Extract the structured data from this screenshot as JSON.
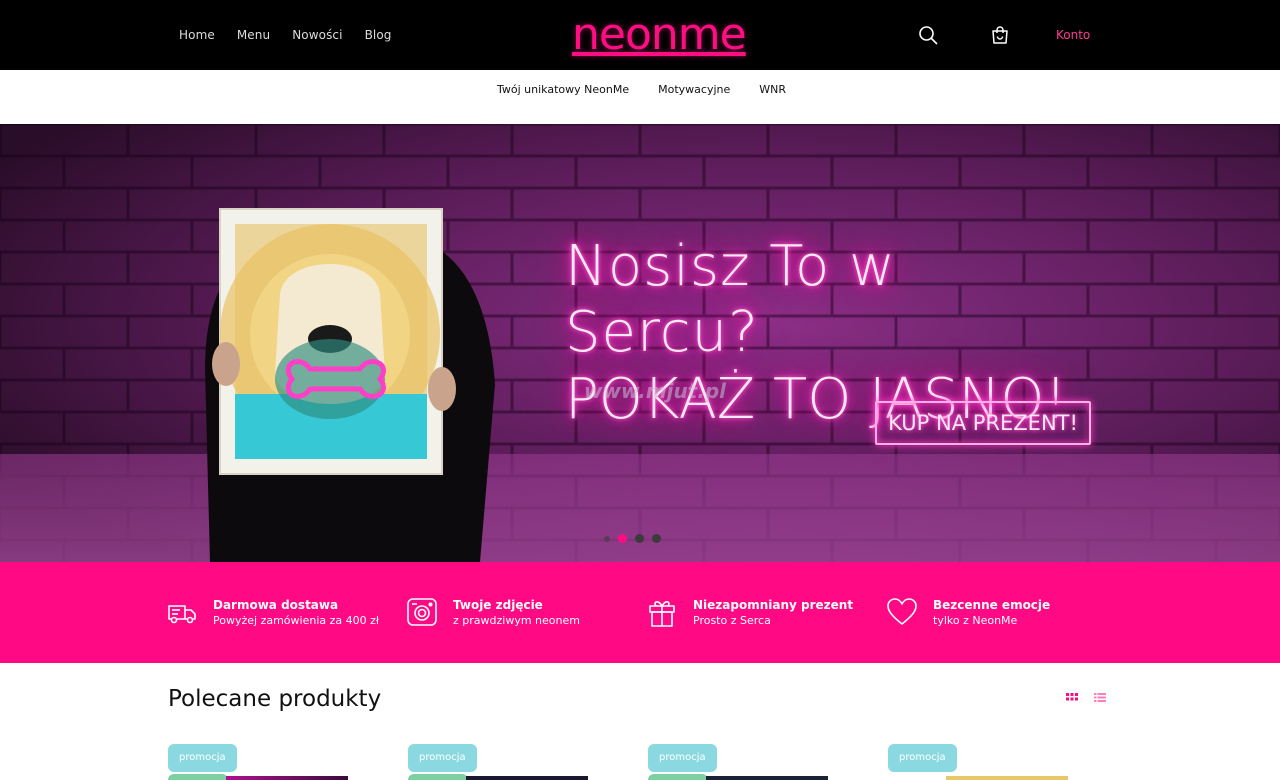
{
  "header": {
    "nav": [
      "Home",
      "Menu",
      "Nowości",
      "Blog"
    ],
    "logo_text": "neonme",
    "account_label": "Konto",
    "icons": {
      "search": "search-icon",
      "cart": "shopping-bag-icon"
    }
  },
  "subnav": {
    "items": [
      "Twój unikatowy NeonMe",
      "Motywacyjne",
      "WNR"
    ]
  },
  "hero": {
    "headline_line1": "Nosisz To w Sercu?",
    "headline_line2": "POKAŻ TO JASNO!",
    "watermark": "www.mjut.pl",
    "cta_label": "KUP NA PREZENT!",
    "slide_count": 3,
    "active_slide": 1
  },
  "features": [
    {
      "icon": "delivery-truck-icon",
      "title": "Darmowa dostawa",
      "subtitle": "Powyżej zamówienia za 400 zł"
    },
    {
      "icon": "camera-icon",
      "title": "Twoje zdjęcie",
      "subtitle": "z prawdziwym neonem"
    },
    {
      "icon": "gift-icon",
      "title": "Niezapomniany prezent",
      "subtitle": "Prosto z Serca"
    },
    {
      "icon": "heart-icon",
      "title": "Bezcenne emocje",
      "subtitle": "tylko z NeonMe"
    }
  ],
  "products": {
    "section_title": "Polecane produkty",
    "view_icons": [
      "grid-view-icon",
      "list-view-icon"
    ],
    "badges": [
      "promocja",
      "promocja",
      "promocja",
      "promocja"
    ]
  },
  "colors": {
    "brand_pink": "#ff0984",
    "header_bg": "#000000",
    "badge_bg": "#8bd9e0"
  }
}
